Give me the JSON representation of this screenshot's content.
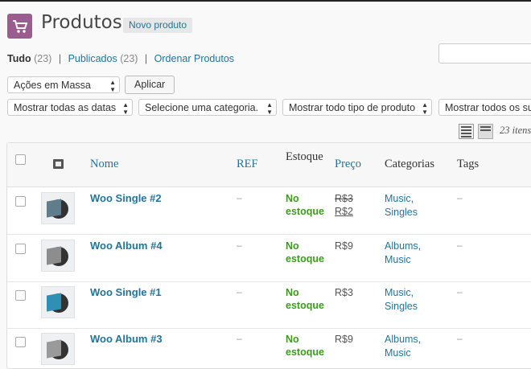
{
  "header": {
    "title": "Produtos",
    "add_new_label": "Novo produto",
    "icon_color": "#9b5c8f"
  },
  "views": [
    {
      "label": "Tudo",
      "count": "(23)"
    },
    {
      "label": "Publicados",
      "count": "(23)"
    },
    {
      "label": "Ordenar Produtos",
      "count": ""
    }
  ],
  "bulk": {
    "selected": "Ações em Massa",
    "apply_label": "Aplicar"
  },
  "filters": {
    "dates": "Mostrar todas as datas",
    "category": "Selecione uma categoria.",
    "product_type": "Mostrar todo tipo de produto",
    "stock": "Mostrar todos os su"
  },
  "items_count": "23 itens",
  "columns": {
    "name": "Nome",
    "sku": "REF",
    "stock": "Estoque",
    "price": "Preço",
    "categories": "Categorias",
    "tags": "Tags"
  },
  "rows": [
    {
      "name": "Woo Single #2",
      "sku": "–",
      "stock_line1": "No",
      "stock_line2": "estoque",
      "price_old": "R$3",
      "price": "R$2",
      "cat1": "Music,",
      "cat2": "Singles",
      "tags": "–",
      "thumb_color": "#607d8b"
    },
    {
      "name": "Woo Album #4",
      "sku": "–",
      "stock_line1": "No",
      "stock_line2": "estoque",
      "price_old": "",
      "price": "R$9",
      "cat1": "Albums,",
      "cat2": "Music",
      "tags": "–",
      "thumb_color": "#8d8d8d"
    },
    {
      "name": "Woo Single #1",
      "sku": "–",
      "stock_line1": "No",
      "stock_line2": "estoque",
      "price_old": "",
      "price": "R$3",
      "cat1": "Music,",
      "cat2": "Singles",
      "tags": "–",
      "thumb_color": "#2f8fb5"
    },
    {
      "name": "Woo Album #3",
      "sku": "–",
      "stock_line1": "No",
      "stock_line2": "estoque",
      "price_old": "",
      "price": "R$9",
      "cat1": "Albums,",
      "cat2": "Music",
      "tags": "–",
      "thumb_color": "#9a9a9a"
    }
  ]
}
